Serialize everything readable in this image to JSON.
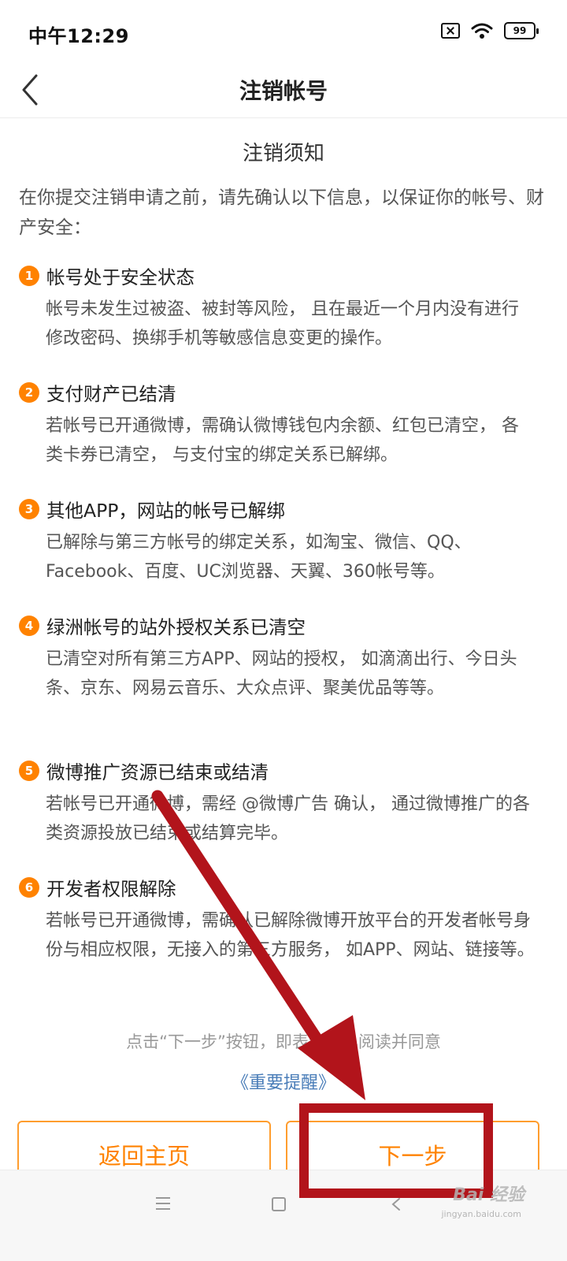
{
  "status_bar": {
    "time": "中午12:29",
    "battery": "99"
  },
  "header": {
    "title": "注销帐号"
  },
  "notice": {
    "title": "注销须知",
    "intro": "在你提交注销申请之前，请先确认以下信息，以保证你的帐号、财产安全："
  },
  "items": [
    {
      "num": "1",
      "title": "帐号处于安全状态",
      "desc": "帐号未发生过被盗、被封等风险， 且在最近一个月内没有进行修改密码、换绑手机等敏感信息变更的操作。"
    },
    {
      "num": "2",
      "title": "支付财产已结清",
      "desc": "若帐号已开通微博，需确认微博钱包内余额、红包已清空， 各类卡券已清空， 与支付宝的绑定关系已解绑。"
    },
    {
      "num": "3",
      "title": "其他APP，网站的帐号已解绑",
      "desc": "已解除与第三方帐号的绑定关系，如淘宝、微信、QQ、Facebook、百度、UC浏览器、天翼、360帐号等。"
    },
    {
      "num": "4",
      "title": "绿洲帐号的站外授权关系已清空",
      "desc": "已清空对所有第三方APP、网站的授权， 如滴滴出行、今日头条、京东、网易云音乐、大众点评、聚美优品等等。"
    },
    {
      "num": "5",
      "title": "微博推广资源已结束或结清",
      "desc": "若帐号已开通微博，需经 @微博广告 确认， 通过微博推广的各类资源投放已结束或结算完毕。"
    },
    {
      "num": "6",
      "title": "开发者权限解除",
      "desc": "若帐号已开通微博，需确认已解除微博开放平台的开发者帐号身份与相应权限，无接入的第三方服务， 如APP、网站、链接等。"
    }
  ],
  "footer": {
    "agree_text": "点击“下一步”按钮，即表示你已阅读并同意",
    "important_link": "《重要提醒》"
  },
  "buttons": {
    "home": "返回主页",
    "next": "下一步"
  },
  "watermark": {
    "text": "Bai 经验",
    "sub": "jingyan.baidu.com"
  },
  "colors": {
    "accent": "#ff8200",
    "annotation": "#b2141b",
    "link": "#4a7db8"
  }
}
